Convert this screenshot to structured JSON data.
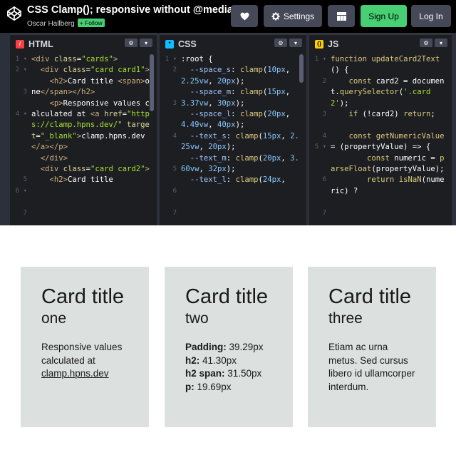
{
  "header": {
    "title": "CSS Clamp(); responsive without @media",
    "author": "Oscar Hallberg",
    "follow_label": "+ Follow",
    "settings_label": "Settings",
    "signup_label": "Sign Up",
    "login_label": "Log In"
  },
  "panes": [
    {
      "name": "HTML"
    },
    {
      "name": "CSS"
    },
    {
      "name": "JS"
    }
  ],
  "cards": [
    {
      "title": "Card title",
      "sub": "one",
      "text": "Responsive values calculated at ",
      "link": "clamp.hpns.dev"
    },
    {
      "title": "Card title",
      "sub": "two",
      "rows": [
        {
          "label": "Padding:",
          "value": " 39.29px"
        },
        {
          "label": "h2:",
          "value": " 41.30px"
        },
        {
          "label": "h2 span:",
          "value": " 31.50px"
        },
        {
          "label": "p:",
          "value": " 19.69px"
        }
      ]
    },
    {
      "title": "Card title",
      "sub": "three",
      "text": "Etiam ac urna metus. Sed cursus libero id ullamcorper interdum."
    }
  ],
  "colors": {
    "accent": "#47cf73",
    "card_bg": "#dce0df",
    "editor_bg": "#1d1e22"
  }
}
